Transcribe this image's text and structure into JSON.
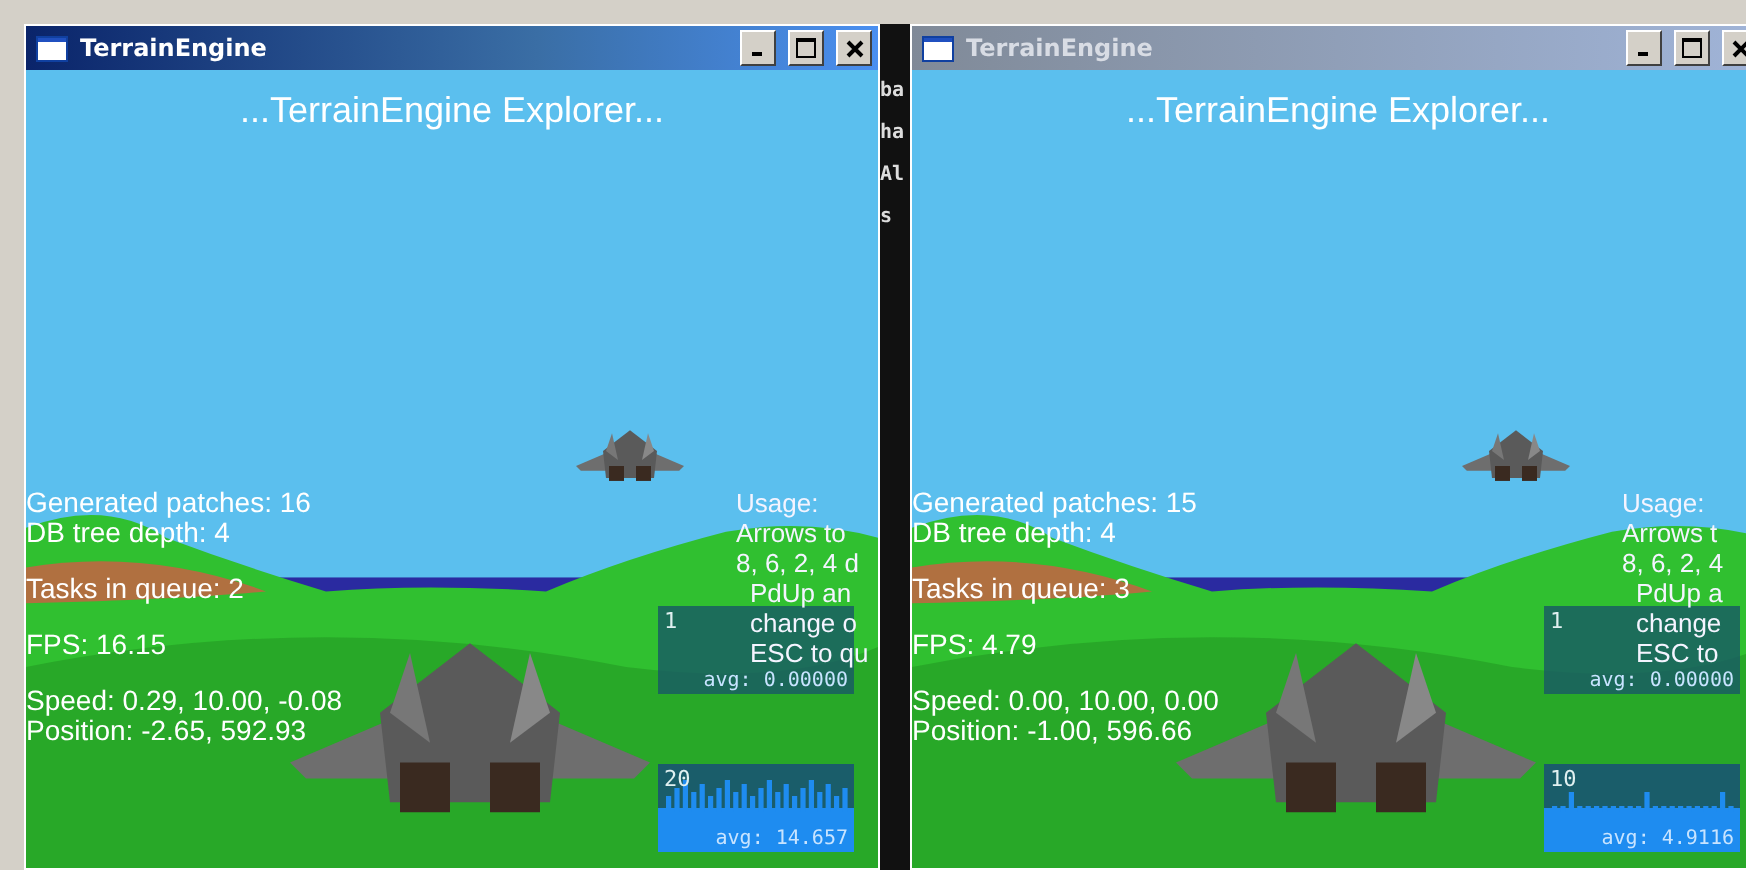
{
  "windows": [
    {
      "title": "TerrainEngine",
      "active": true,
      "heading": "...TerrainEngine Explorer...",
      "stat_groups": [
        {
          "lines": [
            "Generated patches: 16",
            "DB tree depth: 4"
          ]
        },
        {
          "lines": [
            "Tasks in queue: 2"
          ]
        },
        {
          "lines": [
            "FPS: 16.15"
          ]
        },
        {
          "lines": [
            "Speed: 0.29, 10.00, -0.08",
            "Position: -2.65, 592.93"
          ]
        }
      ],
      "usage": [
        "Usage:",
        "Arrows to",
        "8, 6, 2, 4 d",
        "PdUp an",
        "change o",
        "ESC to qu"
      ],
      "graphs": [
        {
          "kind": "flat",
          "scale": "1",
          "avg": "avg: 0.00000"
        },
        {
          "kind": "dense",
          "scale": "20",
          "avg": "avg: 14.657"
        }
      ]
    },
    {
      "title": "TerrainEngine",
      "active": false,
      "heading": "...TerrainEngine Explorer...",
      "stat_groups": [
        {
          "lines": [
            "Generated patches: 15",
            "DB tree depth: 4"
          ]
        },
        {
          "lines": [
            "Tasks in queue: 3"
          ]
        },
        {
          "lines": [
            "FPS: 4.79"
          ]
        },
        {
          "lines": [
            "Speed: 0.00, 10.00, 0.00",
            "Position: -1.00, 596.66"
          ]
        }
      ],
      "usage": [
        "Usage:",
        "Arrows t",
        "8, 6, 2, 4",
        "PdUp a",
        "change",
        "ESC to"
      ],
      "graphs": [
        {
          "kind": "flat",
          "scale": "1",
          "avg": "avg: 0.00000"
        },
        {
          "kind": "sparse",
          "scale": "10",
          "avg": "avg: 4.9116"
        }
      ]
    }
  ],
  "background_fragments": [
    "ba",
    "ha",
    "Al",
    "s"
  ]
}
